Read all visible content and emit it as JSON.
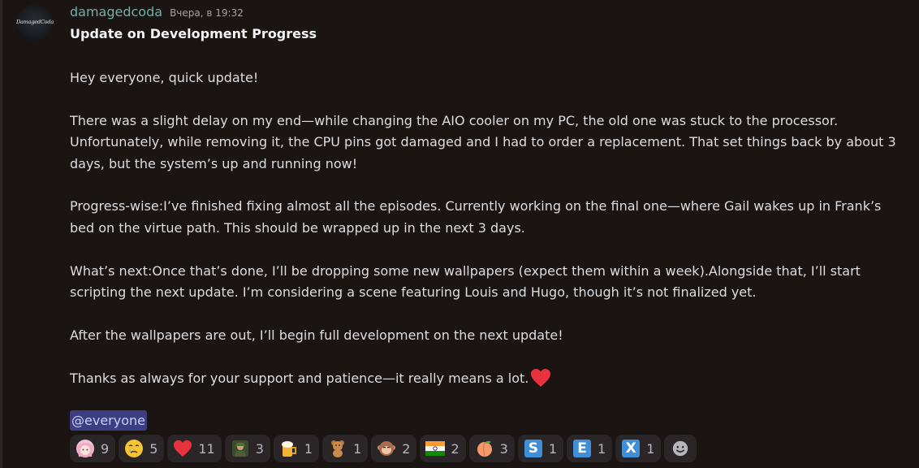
{
  "message": {
    "avatar_text": "DamagedCoda",
    "username": "damagedcoda",
    "timestamp": "Вчера, в 19:32",
    "title": "Update on Development Progress",
    "paragraphs": [
      "Hey everyone, quick update!",
      "There was a slight delay on my end—while changing the AIO cooler on my PC, the old one was stuck to the processor. Unfortunately, while removing it, the CPU pins got damaged and I had to order a replacement. That set things back by about 3 days, but the system’s up and running now!",
      "Progress-wise:I’ve finished fixing almost all the episodes. Currently working on the final one—where Gail wakes up in Frank’s bed on the virtue path. This should be wrapped up in the next 3 days.",
      "What’s next:Once that’s done, I’ll be dropping some new wallpapers (expect them within a week).Alongside that, I’ll start scripting the next update. I’m considering a scene featuring Louis and Hugo, though it’s not finalized yet.",
      "After the wallpapers are out, I’ll begin full development on the next update!",
      "Thanks as always for your support and patience—it really means a lot."
    ],
    "mention": "@everyone"
  },
  "reactions": [
    {
      "emoji": "anime-girl-emoji",
      "count": "9"
    },
    {
      "emoji": "crying-face-emoji",
      "count": "5"
    },
    {
      "emoji": "red-heart-emoji",
      "count": "11"
    },
    {
      "emoji": "soldier-emoji",
      "count": "3"
    },
    {
      "emoji": "beer-mug-emoji",
      "count": "1"
    },
    {
      "emoji": "teddy-bear-emoji",
      "count": "1"
    },
    {
      "emoji": "monkey-face-emoji",
      "count": "2"
    },
    {
      "emoji": "india-flag-emoji",
      "count": "2"
    },
    {
      "emoji": "peach-emoji",
      "count": "3"
    },
    {
      "emoji": "letter-s-emoji",
      "letter": "S",
      "count": "1"
    },
    {
      "emoji": "letter-e-emoji",
      "letter": "E",
      "count": "1"
    },
    {
      "emoji": "letter-x-emoji",
      "letter": "X",
      "count": "1"
    }
  ],
  "colors": {
    "background": "#1a1513",
    "username": "#6fb0a8",
    "mention_bg": "#3b3f82",
    "reaction_bg": "#2a2628",
    "heart": "#e8333f",
    "letter_tile": "#3e8ed8"
  }
}
